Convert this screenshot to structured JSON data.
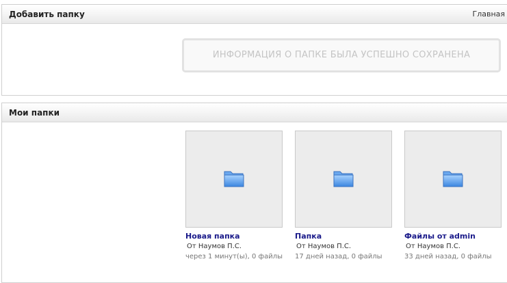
{
  "add_panel": {
    "title": "Добавить папку",
    "home_link": "Главная"
  },
  "notice": {
    "text": "ИНФОРМАЦИЯ О ПАПКЕ БЫЛА УСПЕШНО СОХРАНЕНА"
  },
  "folders_panel": {
    "title": "Мои папки"
  },
  "folders": [
    {
      "name": "Новая папка",
      "owner": "От Наумов П.С.",
      "meta": "через 1 минут(ы), 0 файлы",
      "icon": "folder-icon"
    },
    {
      "name": "Папка",
      "owner": "От Наумов П.С.",
      "meta": "17 дней назад, 0 файлы",
      "icon": "folder-icon"
    },
    {
      "name": "Файлы от admin",
      "owner": "От Наумов П.С.",
      "meta": "33 дней назад, 0 файлы",
      "icon": "folder-icon"
    }
  ]
}
